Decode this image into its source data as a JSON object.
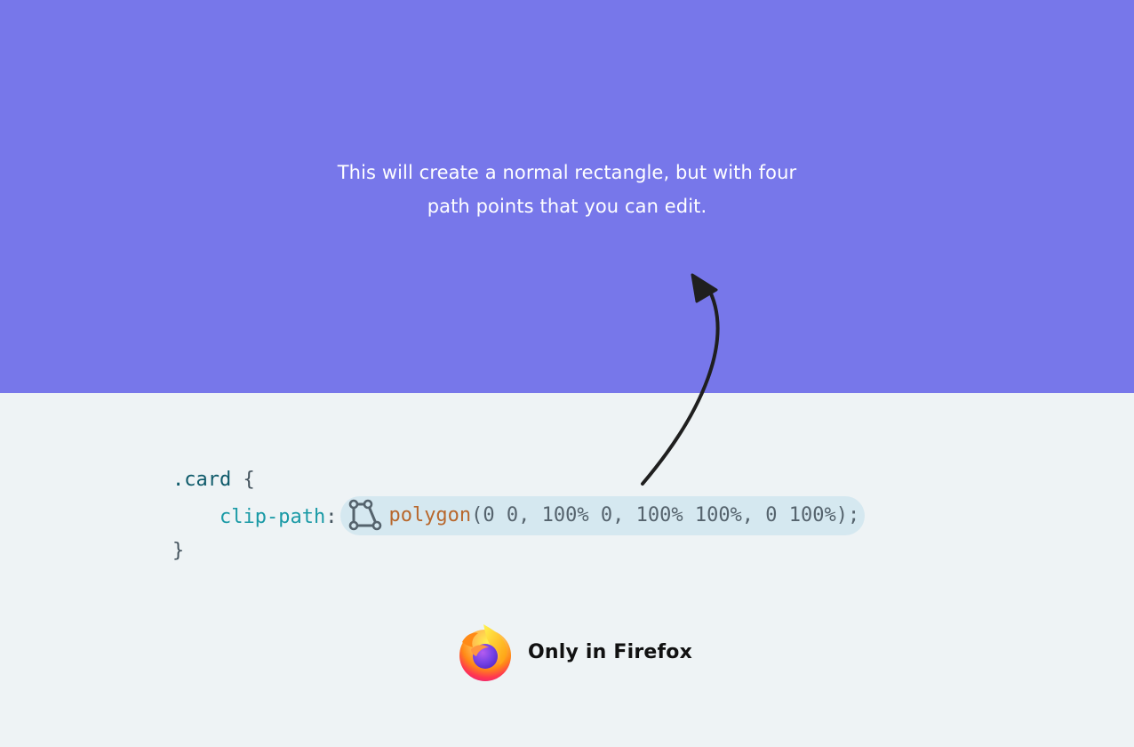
{
  "hero": {
    "line1": "This will create a normal rectangle, but with four",
    "line2": "path points that you can edit."
  },
  "code": {
    "selector": ".card",
    "open_brace": "{",
    "property": "clip-path",
    "colon": ":",
    "function": "polygon",
    "args": "(0 0, 100% 0, 100% 100%, 0 100%);",
    "close_brace": "}",
    "icon": "polygon-editor-icon"
  },
  "footer": {
    "label": "Only in Firefox",
    "logo": "firefox-logo-icon"
  },
  "colors": {
    "hero_bg": "#7777ea",
    "page_bg": "#eef3f5",
    "selector": "#0e5a6a",
    "property": "#1a9aa6",
    "function": "#b8672c",
    "pill_bg": "#d5e8f0"
  }
}
